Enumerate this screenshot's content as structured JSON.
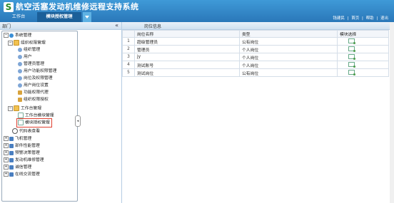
{
  "app": {
    "logo_letter": "S",
    "title": "航空活塞发动机维修远程支持系统"
  },
  "tabs": [
    {
      "label": "工作台"
    },
    {
      "label": "模块授权管理"
    }
  ],
  "toplinks": {
    "user": "钱建民",
    "sep1": "|",
    "home": "首页",
    "sep2": "|",
    "help": "帮助",
    "sep3": "|",
    "logout": "退出"
  },
  "left_panel": {
    "title": "部门",
    "collapse_glyph": "«",
    "side_toggle_glyph": "◂"
  },
  "tree": [
    {
      "label": "系统管理",
      "icon": "globe-icon",
      "expander": "−"
    },
    {
      "label": "组织权限管理",
      "icon": "folder-icon",
      "expander": "−"
    },
    {
      "label": "组织管理",
      "icon": "user-icon"
    },
    {
      "label": "用户",
      "icon": "user-icon"
    },
    {
      "label": "管理员管理",
      "icon": "user-icon"
    },
    {
      "label": "用户功能权限管理",
      "icon": "user-icon"
    },
    {
      "label": "岗位及权限管理",
      "icon": "user-icon"
    },
    {
      "label": "用户岗位设置",
      "icon": "user-icon"
    },
    {
      "label": "功能权限代理",
      "icon": "key-icon"
    },
    {
      "label": "组织权限授权",
      "icon": "key-icon"
    },
    {
      "label": "工作台管理",
      "icon": "folder-icon",
      "expander": "−"
    },
    {
      "label": "工作台模块管理",
      "icon": "page-icon"
    },
    {
      "label": "模块授权管理",
      "icon": "page-icon"
    },
    {
      "label": "代码表查看",
      "icon": "search-icon"
    },
    {
      "label": "飞机管理",
      "icon": "plane-icon",
      "expander": "+"
    },
    {
      "label": "部件性能管理",
      "icon": "plane-icon",
      "expander": "+"
    },
    {
      "label": "预警决策管理",
      "icon": "plane-icon",
      "expander": "+"
    },
    {
      "label": "发动机维修管理",
      "icon": "plane-icon",
      "expander": "+"
    },
    {
      "label": "诚信管理",
      "icon": "plane-icon",
      "expander": "+"
    },
    {
      "label": "在线交流管理",
      "icon": "plane-icon",
      "expander": "+"
    }
  ],
  "right_panel": {
    "title": "岗位信息"
  },
  "table": {
    "headers": [
      "岗位名称",
      "类型",
      "模块选择"
    ],
    "rows": [
      {
        "idx": "1",
        "name": "超级管理员",
        "type": "公有岗位"
      },
      {
        "idx": "2",
        "name": "管理员",
        "type": "个人岗位"
      },
      {
        "idx": "3",
        "name": "jy",
        "type": "个人岗位"
      },
      {
        "idx": "4",
        "name": "测试账号",
        "type": "个人岗位"
      },
      {
        "idx": "5",
        "name": "测试岗位",
        "type": "公有岗位"
      }
    ]
  },
  "colors": {
    "header": "#2a77b9",
    "active_tab": "#1b5f99",
    "highlight": "#e04030"
  }
}
